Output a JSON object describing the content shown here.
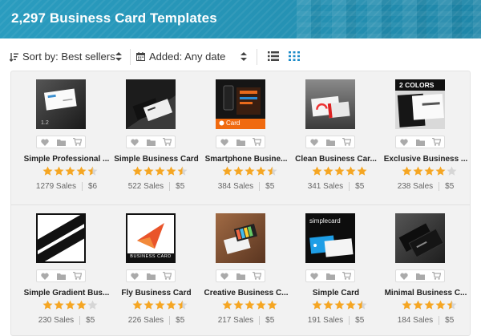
{
  "header": {
    "title": "2,297 Business Card Templates"
  },
  "toolbar": {
    "sort_label": "Sort by: Best sellers",
    "added_label": "Added: Any date",
    "active_view": "grid",
    "accent_color": "#1b8bc8"
  },
  "cards": [
    {
      "name": "Simple Professional ...",
      "rating": 4.5,
      "sales": "1279 Sales",
      "price": "$6",
      "thumb_tag": ""
    },
    {
      "name": "Simple Business Card",
      "rating": 4.5,
      "sales": "522 Sales",
      "price": "$5",
      "thumb_tag": ""
    },
    {
      "name": "Smartphone Busine...",
      "rating": 4.5,
      "sales": "384 Sales",
      "price": "$5",
      "thumb_tag": "Card"
    },
    {
      "name": "Clean Business Car...",
      "rating": 5,
      "sales": "341 Sales",
      "price": "$5",
      "thumb_tag": ""
    },
    {
      "name": "Exclusive Business ...",
      "rating": 4,
      "sales": "238 Sales",
      "price": "$5",
      "thumb_tag": "2 COLORS"
    },
    {
      "name": "Simple Gradient Bus...",
      "rating": 4,
      "sales": "230 Sales",
      "price": "$5",
      "thumb_tag": ""
    },
    {
      "name": "Fly Business Card",
      "rating": 4.5,
      "sales": "226 Sales",
      "price": "$5",
      "thumb_tag": "BUSINESS CARD"
    },
    {
      "name": "Creative Business C...",
      "rating": 5,
      "sales": "217 Sales",
      "price": "$5",
      "thumb_tag": ""
    },
    {
      "name": "Simple Card",
      "rating": 4.5,
      "sales": "191 Sales",
      "price": "$5",
      "thumb_tag": "simplecard"
    },
    {
      "name": "Minimal Business C...",
      "rating": 4.5,
      "sales": "184 Sales",
      "price": "$5",
      "thumb_tag": ""
    }
  ],
  "colors": {
    "star": "#f5a623",
    "star_empty": "#d6d6d6",
    "banner": "#2796b8"
  }
}
